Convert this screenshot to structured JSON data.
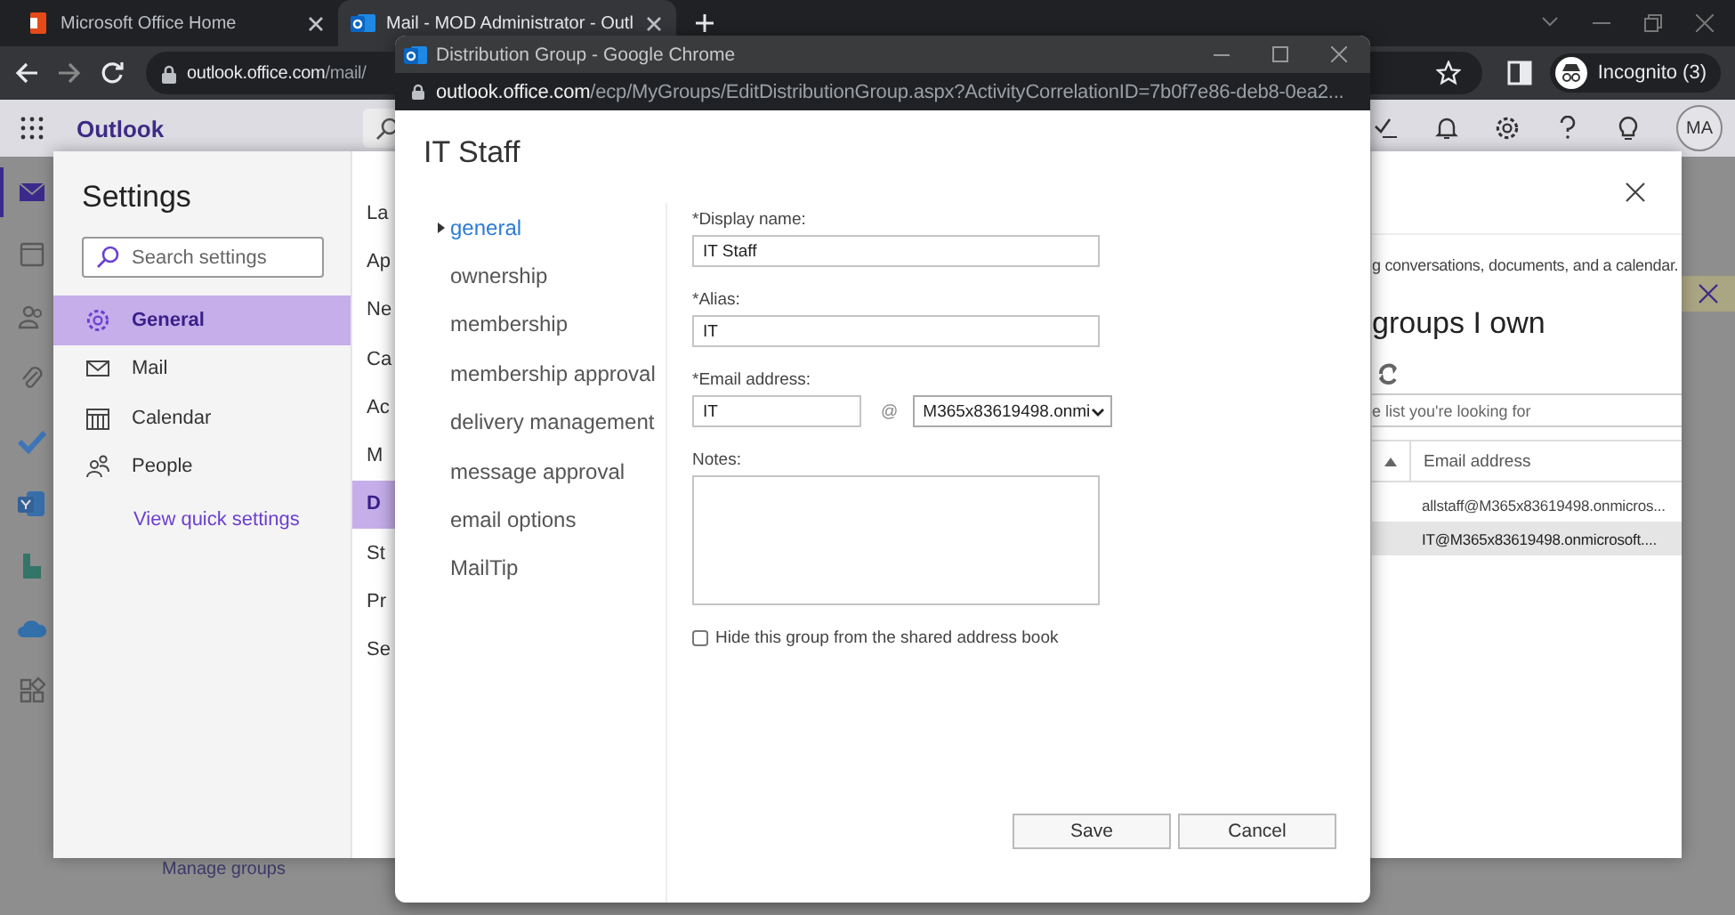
{
  "browser": {
    "tabs": [
      {
        "label": "Microsoft Office Home",
        "selected": false
      },
      {
        "label": "Mail - MOD Administrator - Outl",
        "selected": true
      }
    ],
    "url": {
      "host": "outlook.office.com",
      "path": "/mail/"
    },
    "profile": "Incognito (3)"
  },
  "outlook": {
    "app_name": "Outlook",
    "avatar": "MA",
    "rail": [
      {
        "selected": true
      },
      {
        "selected": false
      },
      {
        "selected": false
      },
      {
        "selected": false
      },
      {
        "selected": false
      },
      {
        "selected": false
      },
      {
        "selected": false
      },
      {
        "selected": false
      },
      {
        "selected": false
      }
    ],
    "manage_link": "Manage groups"
  },
  "settings": {
    "title": "Settings",
    "search": {
      "placeholder": "Search settings"
    },
    "categories": [
      {
        "label": "General",
        "selected": true
      },
      {
        "label": "Mail",
        "selected": false
      },
      {
        "label": "Calendar",
        "selected": false
      },
      {
        "label": "People",
        "selected": false
      }
    ],
    "quick_link": "View quick settings",
    "subcategories": [
      {
        "label": "La",
        "selected": false
      },
      {
        "label": "Ap",
        "selected": false
      },
      {
        "label": "Ne",
        "selected": false
      },
      {
        "label": "Ca",
        "selected": false
      },
      {
        "label": "Ac",
        "selected": false
      },
      {
        "label": "M",
        "selected": false
      },
      {
        "label": "D",
        "selected": true
      },
      {
        "label": "St",
        "selected": false
      },
      {
        "label": "Pr",
        "selected": false
      },
      {
        "label": "Se",
        "selected": false
      }
    ],
    "description": "g conversations, documents, and a calendar.",
    "heading": "groups I own",
    "list_search": {
      "placeholder": "e list you're looking for"
    },
    "table": {
      "columns": [
        "Email address"
      ],
      "rows": [
        {
          "email": "allstaff@M365x83619498.onmicros...",
          "selected": false
        },
        {
          "email": "IT@M365x83619498.onmicrosoft....",
          "selected": true
        }
      ]
    }
  },
  "popup": {
    "title": "Distribution Group - Google Chrome",
    "url": {
      "host": "outlook.office.com",
      "path": "/ecp/MyGroups/EditDistributionGroup.aspx?ActivityCorrelationID=7b0f7e86-deb8-0ea2..."
    },
    "heading": "IT Staff",
    "nav": [
      {
        "label": "general",
        "selected": true
      },
      {
        "label": "ownership",
        "selected": false
      },
      {
        "label": "membership",
        "selected": false
      },
      {
        "label": "membership approval",
        "selected": false
      },
      {
        "label": "delivery management",
        "selected": false
      },
      {
        "label": "message approval",
        "selected": false
      },
      {
        "label": "email options",
        "selected": false
      },
      {
        "label": "MailTip",
        "selected": false
      }
    ],
    "form": {
      "display_name": {
        "label": "*Display name:",
        "value": "IT Staff"
      },
      "alias": {
        "label": "*Alias:",
        "value": "IT"
      },
      "email": {
        "label": "*Email address:",
        "value": "IT",
        "at": "@",
        "domain": "M365x83619498.onmi"
      },
      "notes": {
        "label": "Notes:"
      },
      "hide": {
        "label": "Hide this group from the shared address book",
        "checked": false
      }
    },
    "buttons": [
      "Save",
      "Cancel"
    ]
  }
}
